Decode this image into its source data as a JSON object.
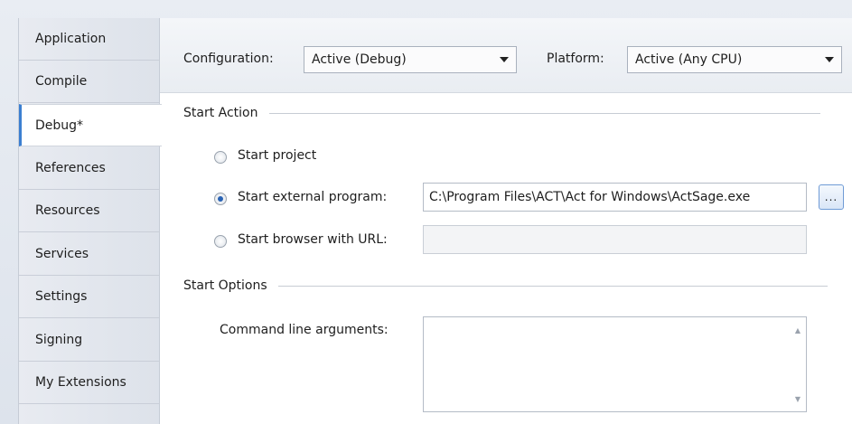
{
  "tabs": [
    {
      "label": "Application"
    },
    {
      "label": "Compile"
    },
    {
      "label": "Debug*"
    },
    {
      "label": "References"
    },
    {
      "label": "Resources"
    },
    {
      "label": "Services"
    },
    {
      "label": "Settings"
    },
    {
      "label": "Signing"
    },
    {
      "label": "My Extensions"
    }
  ],
  "active_tab": "Debug*",
  "toolbar": {
    "configuration_label": "Configuration:",
    "configuration_value": "Active (Debug)",
    "platform_label": "Platform:",
    "platform_value": "Active (Any CPU)"
  },
  "start_action": {
    "heading": "Start Action",
    "options": [
      {
        "label": "Start project",
        "checked": false
      },
      {
        "label": "Start external program:",
        "checked": true
      },
      {
        "label": "Start browser with URL:",
        "checked": false
      }
    ],
    "external_program_path": "C:\\Program Files\\ACT\\Act for Windows\\ActSage.exe",
    "browse_label": "...",
    "browser_url": ""
  },
  "start_options": {
    "heading": "Start Options",
    "command_line_label": "Command line arguments:",
    "command_line_value": ""
  },
  "colors": {
    "accent": "#3b7fd1",
    "radio_checked": "#2a63b4"
  }
}
